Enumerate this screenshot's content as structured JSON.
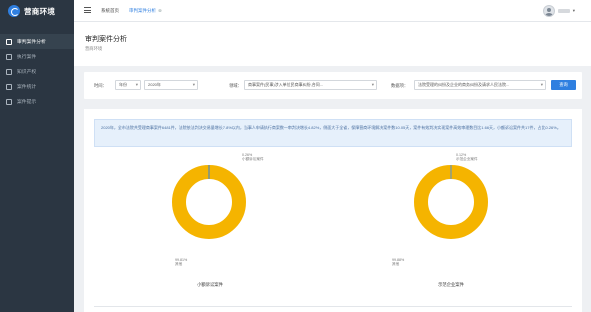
{
  "app": {
    "logo_text": "营商环境"
  },
  "sidebar": {
    "items": [
      {
        "label": "审判案件分析",
        "active": true
      },
      {
        "label": "执行案件"
      },
      {
        "label": "知识产权"
      },
      {
        "label": "案件统计"
      },
      {
        "label": "案件提示"
      }
    ]
  },
  "topbar": {
    "tabs": [
      {
        "label": "系统首页"
      },
      {
        "label": "审判案件分析",
        "active": true,
        "close": "⊗"
      }
    ],
    "user_caret": "▾"
  },
  "page": {
    "title": "审判案件分析",
    "subtitle": "营商环境"
  },
  "filters": {
    "time_label": "时间：",
    "period_value": "年份",
    "year_value": "2020年",
    "domain_label": "领域：",
    "domain_value": "商事案件(民事)涉入单位民商事纠纷,合同...",
    "data_label": "数据项：",
    "data_value": "法院受理的纠纷及企业的商务纠纷及请求人民法院...",
    "query_button": "查询"
  },
  "summary": {
    "text": "2020年，全市法院共受理商事案件6481件，法院依法判决交易量增长7.8%以内，当事人申请执行商案数一审判决增长4.82%，侧面大于全省，保障营商环境解决案件数10.05天，案件有效判决实现案件高效审理数目比1.66天，小额诉讼案件共17件，占比0.26%。"
  },
  "colors": {
    "ring": "#f5b400",
    "accent": "#2f7fe0",
    "slice_small": "#2f7fe0",
    "slice_two": "#4f8fd9"
  },
  "charts": [
    {
      "title": "小额诉讼案件",
      "slice_top_value": "0.26%",
      "slice_top_label": "小额诉讼案件",
      "slice_bottom_value": "99.81%",
      "slice_bottom_label": "其他"
    },
    {
      "title": "示范企业案件",
      "slice_top_value": "0.12%",
      "slice_top_label": "示范企业案件",
      "slice_bottom_value": "99.88%",
      "slice_bottom_label": "其他"
    }
  ]
}
